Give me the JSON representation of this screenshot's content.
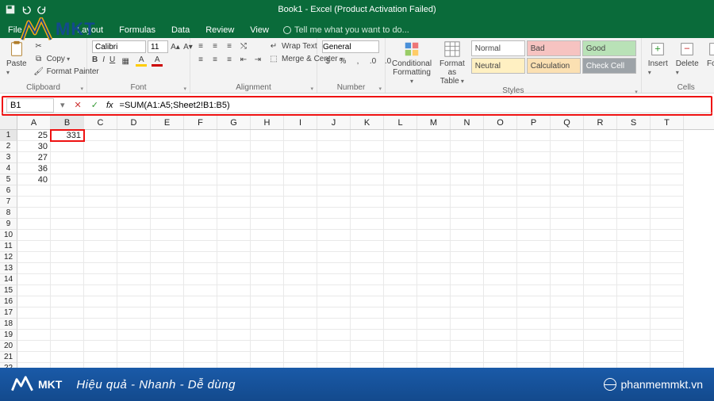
{
  "app": {
    "title": "Book1 - Excel (Product Activation Failed)"
  },
  "tabs": {
    "file": "File",
    "layout": "Layout",
    "formulas": "Formulas",
    "data": "Data",
    "review": "Review",
    "view": "View",
    "tell_me": "Tell me what you want to do..."
  },
  "ribbon": {
    "clipboard": {
      "paste": "Paste",
      "copy": "Copy",
      "format_painter": "Format Painter",
      "label": "Clipboard"
    },
    "font": {
      "name": "Calibri",
      "size": "11",
      "label": "Font"
    },
    "alignment": {
      "wrap": "Wrap Text",
      "merge": "Merge & Center",
      "label": "Alignment"
    },
    "number": {
      "format": "General",
      "label": "Number"
    },
    "styles": {
      "conditional": "Conditional\nFormatting",
      "format_table": "Format as\nTable",
      "cellstyles": [
        "Normal",
        "Bad",
        "Good",
        "Neutral",
        "Calculation",
        "Check Cell"
      ],
      "label": "Styles"
    },
    "cells": {
      "insert": "Insert",
      "delete": "Delete",
      "format_cells_label": "For",
      "label": "Cells"
    }
  },
  "namebox": "B1",
  "formula": "=SUM(A1:A5;Sheet2!B1:B5)",
  "columns": [
    "A",
    "B",
    "C",
    "D",
    "E",
    "F",
    "G",
    "H",
    "I",
    "J",
    "K",
    "L",
    "M",
    "N",
    "O",
    "P",
    "Q",
    "R",
    "S",
    "T"
  ],
  "row_count": 22,
  "data_cells": {
    "A": {
      "1": "25",
      "2": "30",
      "3": "27",
      "4": "36",
      "5": "40"
    },
    "B": {
      "1": "331"
    }
  },
  "selected_cell": "B1",
  "watermark": {
    "text": "MKT"
  },
  "footer": {
    "brand": "MKT",
    "slogan": "Hiệu quả - Nhanh  - Dễ dùng",
    "site": "phanmemmkt.vn"
  },
  "colors": {
    "style_bad_bg": "#f6c3c1",
    "style_good_bg": "#b9e2b7",
    "style_neutral_bg": "#fff0c2",
    "style_calc_bg": "#fbe0b2",
    "style_check_bg": "#9da3a8"
  }
}
